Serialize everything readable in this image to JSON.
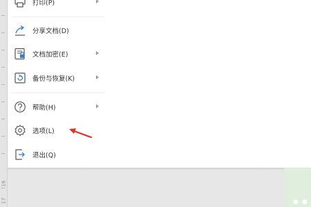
{
  "ruler": {
    "numbers": [
      "16",
      "17"
    ]
  },
  "menu": {
    "items": [
      {
        "label": "打印(P)",
        "icon": "printer-icon",
        "has_submenu": true
      },
      {
        "label": "分享文档(D)",
        "icon": "share-icon",
        "has_submenu": false
      },
      {
        "label": "文档加密(E)",
        "icon": "encrypt-icon",
        "has_submenu": true
      },
      {
        "label": "备份与恢复(K)",
        "icon": "backup-restore-icon",
        "has_submenu": true
      },
      {
        "label": "帮助(H)",
        "icon": "help-icon",
        "has_submenu": true
      },
      {
        "label": "选项(L)",
        "icon": "gear-icon",
        "has_submenu": false
      },
      {
        "label": "退出(Q)",
        "icon": "exit-icon",
        "has_submenu": false
      }
    ]
  },
  "annotation": {
    "arrow_color": "#e8302a",
    "points_to": "选项(L)"
  },
  "colors": {
    "icon_blue": "#2f7fd6",
    "icon_gray": "#555555",
    "thumbnail_green": "#dfeedd"
  }
}
